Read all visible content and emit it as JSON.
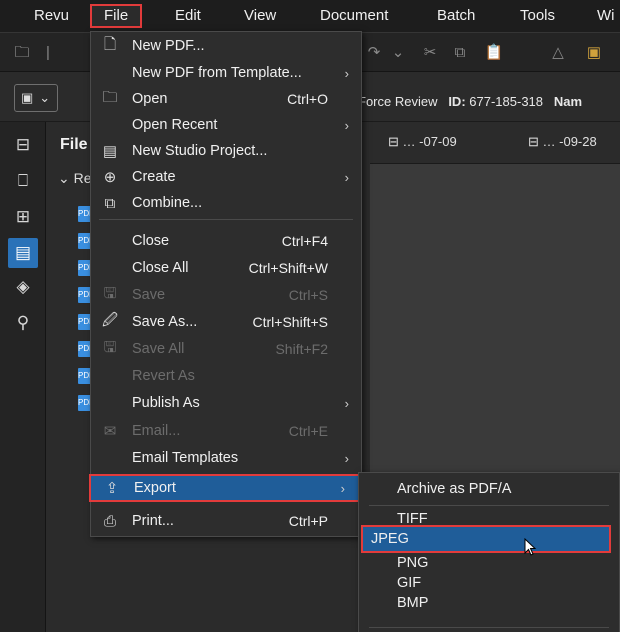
{
  "menubar": {
    "items": [
      "Revu",
      "File",
      "Edit",
      "View",
      "Document",
      "Batch",
      "Tools",
      "Wi"
    ]
  },
  "docrow": {
    "selector_glyph": "▣",
    "info_prefix": "Force Review",
    "id_label": "ID:",
    "id_value": "677-185-318",
    "name_label": "Nam"
  },
  "filepanel": {
    "title": "File",
    "node": "Re"
  },
  "tabs": [
    "… -07-09",
    "… -09-28"
  ],
  "file_menu": {
    "items": [
      {
        "label": "New PDF...",
        "shortcut": "",
        "icon": "new-pdf-icon"
      },
      {
        "label": "New PDF from Template...",
        "shortcut": "",
        "icon": ""
      },
      {
        "label": "Open",
        "shortcut": "Ctrl+O",
        "icon": "folder-icon"
      },
      {
        "label": "Open Recent",
        "shortcut": "",
        "icon": ""
      },
      {
        "label": "New Studio Project...",
        "shortcut": "",
        "icon": "studio-project-icon"
      },
      {
        "label": "Create",
        "shortcut": "",
        "icon": "create-plus-icon"
      },
      {
        "label": "Combine...",
        "shortcut": "",
        "icon": "combine-icon"
      },
      {
        "label": "Close",
        "shortcut": "Ctrl+F4",
        "icon": ""
      },
      {
        "label": "Close All",
        "shortcut": "Ctrl+Shift+W",
        "icon": ""
      },
      {
        "label": "Save",
        "shortcut": "Ctrl+S",
        "icon": "save-icon"
      },
      {
        "label": "Save As...",
        "shortcut": "Ctrl+Shift+S",
        "icon": "save-as-icon"
      },
      {
        "label": "Save All",
        "shortcut": "Shift+F2",
        "icon": "save-all-icon"
      },
      {
        "label": "Revert As",
        "shortcut": "",
        "icon": ""
      },
      {
        "label": "Publish As",
        "shortcut": "",
        "icon": ""
      },
      {
        "label": "Email...",
        "shortcut": "Ctrl+E",
        "icon": "email-icon"
      },
      {
        "label": "Email Templates",
        "shortcut": "",
        "icon": ""
      },
      {
        "label": "Export",
        "shortcut": "",
        "icon": "export-icon"
      },
      {
        "label": "Print...",
        "shortcut": "Ctrl+P",
        "icon": "print-icon"
      }
    ]
  },
  "export_submenu": {
    "items": [
      "Archive as PDF/A",
      "TIFF",
      "JPEG",
      "PNG",
      "GIF",
      "BMP"
    ]
  },
  "colors": {
    "highlight": "#1f5d99",
    "annotation_red": "#e23b3b",
    "rail_selected": "#2a72b8"
  }
}
